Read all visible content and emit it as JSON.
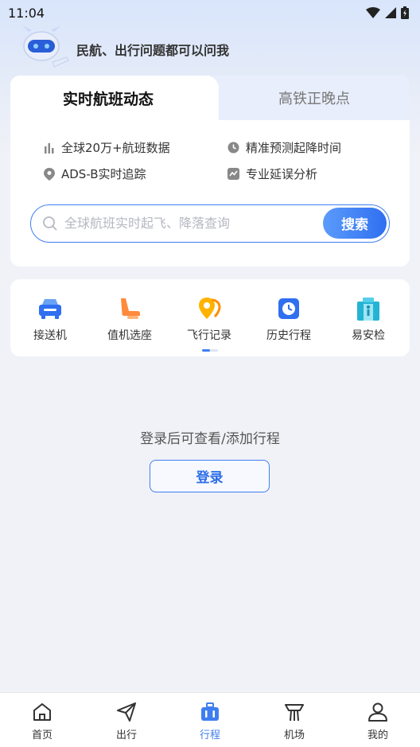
{
  "status_bar": {
    "time": "11:04"
  },
  "assistant": {
    "text": "民航、出行问题都可以问我"
  },
  "flight_card": {
    "tabs": [
      {
        "label": "实时航班动态",
        "active": true
      },
      {
        "label": "高铁正晚点",
        "active": false
      }
    ],
    "features": [
      {
        "icon": "bar-chart-icon",
        "label": "全球20万+航班数据"
      },
      {
        "icon": "clock-icon",
        "label": "精准预测起降时间"
      },
      {
        "icon": "location-pin-icon",
        "label": "ADS-B实时追踪"
      },
      {
        "icon": "trend-chart-icon",
        "label": "专业延误分析"
      }
    ],
    "search": {
      "placeholder": "全球航班实时起飞、降落查询",
      "button_label": "搜索"
    }
  },
  "services": [
    {
      "icon": "car-icon",
      "label": "接送机"
    },
    {
      "icon": "seat-icon",
      "label": "值机选座"
    },
    {
      "icon": "flight-record-icon",
      "label": "飞行记录"
    },
    {
      "icon": "history-clock-icon",
      "label": "历史行程"
    },
    {
      "icon": "security-check-icon",
      "label": "易安检"
    }
  ],
  "empty_state": {
    "hint": "登录后可查看/添加行程",
    "login_label": "登录"
  },
  "bottom_nav": [
    {
      "icon": "home-icon",
      "label": "首页",
      "active": false
    },
    {
      "icon": "paper-plane-icon",
      "label": "出行",
      "active": false
    },
    {
      "icon": "suitcase-icon",
      "label": "行程",
      "active": true
    },
    {
      "icon": "airport-tower-icon",
      "label": "机场",
      "active": false
    },
    {
      "icon": "person-icon",
      "label": "我的",
      "active": false
    }
  ],
  "colors": {
    "accent": "#3f7ef0",
    "background": "#f1f2f7",
    "inactive_tab": "#e8eefb"
  }
}
